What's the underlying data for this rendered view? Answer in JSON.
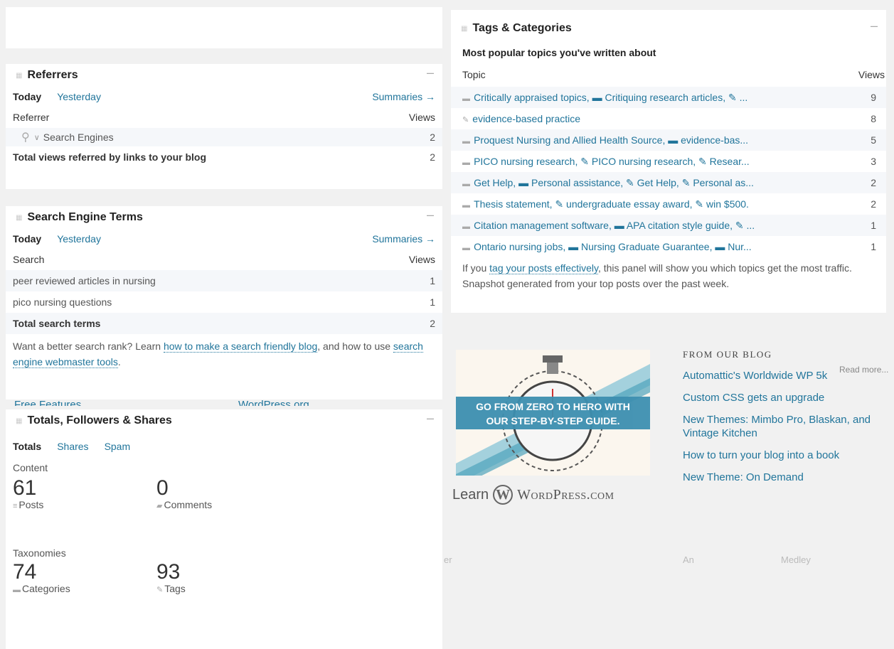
{
  "referrers": {
    "title": "Referrers",
    "tab_today": "Today",
    "tab_yesterday": "Yesterday",
    "summaries": "Summaries →",
    "col_referrer": "Referrer",
    "col_views": "Views",
    "search_engines_label": "Search Engines",
    "search_engines_views": "2",
    "total_label": "Total views referred by links to your blog",
    "total_views": "2"
  },
  "search_terms": {
    "title": "Search Engine Terms",
    "tab_today": "Today",
    "tab_yesterday": "Yesterday",
    "summaries": "Summaries →",
    "col_search": "Search",
    "col_views": "Views",
    "rows": [
      {
        "term": "peer reviewed articles in nursing",
        "views": "1"
      },
      {
        "term": "pico nursing questions",
        "views": "1"
      }
    ],
    "total_label": "Total search terms",
    "total_views": "2",
    "note_prefix": "Want a better search rank? Learn ",
    "note_link1": "how to make a search friendly blog",
    "note_mid": ", and how to use ",
    "note_link2": "search engine webmaster tools",
    "note_suffix": "."
  },
  "behind_text": {
    "free_features": "Free Features",
    "wordpress_org": "WordPress.org",
    "fragment_er": "er",
    "an": "An",
    "medley": "Medley"
  },
  "totals": {
    "title": "Totals, Followers & Shares",
    "tab_totals": "Totals",
    "tab_shares": "Shares",
    "tab_spam": "Spam",
    "content_label": "Content",
    "posts_num": "61",
    "posts_label": "Posts",
    "comments_num": "0",
    "comments_label": "Comments",
    "taxonomies_label": "Taxonomies",
    "categories_num": "74",
    "categories_label": "Categories",
    "tags_num": "93",
    "tags_label": "Tags"
  },
  "tags": {
    "title": "Tags & Categories",
    "subtitle": "Most popular topics you've written about",
    "col_topic": "Topic",
    "col_views": "Views",
    "rows": [
      {
        "topic": "Critically appraised topics, ▬ Critiquing research articles, ✎ ...",
        "views": "9",
        "icon": "folder-icon"
      },
      {
        "topic": "evidence-based practice",
        "views": "8",
        "icon": "tag-icon"
      },
      {
        "topic": "Proquest Nursing and Allied Health Source, ▬ evidence-bas...",
        "views": "5",
        "icon": "folder-icon"
      },
      {
        "topic": "PICO nursing research, ✎ PICO nursing research, ✎ Resear...",
        "views": "3",
        "icon": "folder-icon"
      },
      {
        "topic": "Get Help, ▬ Personal assistance, ✎ Get Help, ✎ Personal as...",
        "views": "2",
        "icon": "folder-icon"
      },
      {
        "topic": "Thesis statement, ✎ undergraduate essay award, ✎ win $500.",
        "views": "2",
        "icon": "folder-icon"
      },
      {
        "topic": "Citation management software, ▬ APA citation style guide, ✎ ...",
        "views": "1",
        "icon": "folder-icon"
      },
      {
        "topic": "Ontario nursing jobs, ▬ Nursing Graduate Guarantee, ▬ Nur...",
        "views": "1",
        "icon": "folder-icon"
      }
    ],
    "note_prefix": "If you ",
    "note_link": "tag your posts effectively",
    "note_suffix": ", this panel will show you which topics get the most traffic. Snapshot generated from your top posts over the past week."
  },
  "promo": {
    "banner_line1": "GO FROM ZERO TO HERO WITH",
    "banner_line2": "OUR STEP-BY-STEP GUIDE.",
    "learn": "Learn",
    "brand": "WordPress.com"
  },
  "blog": {
    "heading": "FROM OUR BLOG",
    "read_more": "Read more...",
    "posts": [
      "Automattic's Worldwide WP 5k",
      "Custom CSS gets an upgrade",
      "New Themes: Mimbo Pro, Blaskan, and Vintage Kitchen",
      "How to turn your blog into a book",
      "New Theme: On Demand"
    ]
  }
}
